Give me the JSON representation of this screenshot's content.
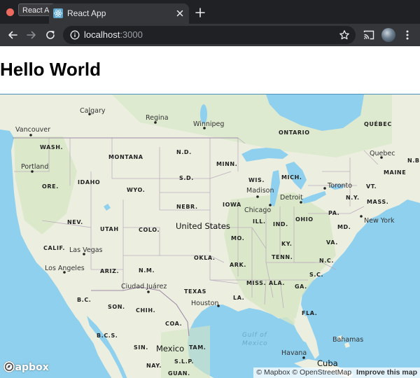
{
  "browser": {
    "tooltip": "React App",
    "tab": {
      "title": "React App"
    },
    "omnibox": {
      "host": "localhost",
      "port": ":3000"
    }
  },
  "page": {
    "heading": "Hello World"
  },
  "map": {
    "countries": {
      "usa": "United States",
      "mexico": "Mexico",
      "cuba": "Cuba"
    },
    "water": {
      "gulf_line1": "Gulf of",
      "gulf_line2": "Mexico"
    },
    "cities": {
      "calgary": "Calgary",
      "regina": "Regina",
      "winnipeg": "Winnipeg",
      "vancouver": "Vancouver",
      "portland": "Portland",
      "quebec": "Quebec",
      "toronto": "Toronto",
      "madison": "Madison",
      "detroit": "Detroit",
      "chicago": "Chicago",
      "new_york": "New York",
      "las_vegas": "Las Vegas",
      "los_angeles": "Los Angeles",
      "ciudad_juarez": "Ciudad Juárez",
      "houston": "Houston",
      "havana": "Havana",
      "bahamas": "Bahamas"
    },
    "regions": {
      "ontario": "ONTARIO",
      "quebec": "QUÉBEC",
      "nb": "N.B",
      "maine": "MAINE",
      "vt": "VT.",
      "ny": "N.Y.",
      "mass": "MASS.",
      "pa": "PA.",
      "md": "MD.",
      "ohio": "OHIO",
      "ind": "IND.",
      "ill": "ILL.",
      "mich": "MICH.",
      "wis": "WIS.",
      "minn": "MINN.",
      "iowa": "IOWA",
      "mo": "MO.",
      "ky": "KY.",
      "va": "VA.",
      "nc": "N.C.",
      "tenn": "TENN.",
      "sc": "S.C.",
      "ga": "GA.",
      "ala": "ALA.",
      "miss": "MISS.",
      "ark": "ARK.",
      "la": "LA.",
      "fla": "FLA.",
      "okla": "OKLA.",
      "texas": "TEXAS",
      "nm": "N.M.",
      "ariz": "ARIZ.",
      "colo": "COLO.",
      "utah": "UTAH",
      "nev": "NEV.",
      "calif": "CALIF.",
      "ore": "ORE.",
      "wash": "WASH.",
      "idaho": "IDAHO",
      "montana": "MONTANA",
      "wyo": "WYO.",
      "nd": "N.D.",
      "sd": "S.D.",
      "nebr": "NEBR.",
      "bc": "B.C.",
      "bcs": "B.C.S.",
      "son": "SON.",
      "chih": "CHIH.",
      "coa": "COA.",
      "sin": "SIN.",
      "tam": "TAM.",
      "slp": "S.L.P.",
      "nay": "NAY.",
      "guan": "GUAN."
    },
    "logo": "mapbox",
    "attribution": {
      "mapbox": "© Mapbox",
      "osm": "© OpenStreetMap",
      "improve": "Improve this map"
    }
  },
  "colors": {
    "land": "#ecefe0",
    "water": "#8fd0ee",
    "vegetation": "#d6e6c3",
    "border": "#b9a6bd",
    "chrome": "#35363a"
  }
}
